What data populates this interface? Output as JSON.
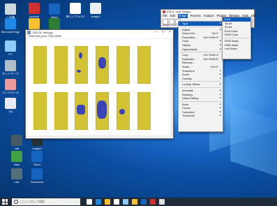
{
  "desktop": {
    "icons_left": [
      {
        "label": "ごみ箱",
        "icon": "recycle-bin-icon",
        "color": "#cfd8dc"
      },
      {
        "label": "Microsoft Edge",
        "icon": "edge-icon",
        "color": "#1e88e5"
      },
      {
        "label": "PC",
        "icon": "pc-icon",
        "color": "#90caf9"
      },
      {
        "label": "ネットワーク",
        "icon": "network-icon",
        "color": "#b0bec5"
      },
      {
        "label": "コントロール",
        "icon": "control-panel-icon",
        "color": "#ef9a9a"
      },
      {
        "label": "Fiji",
        "icon": "fiji-icon",
        "color": "#e8eaf6"
      }
    ],
    "icons_top": [
      {
        "label": "Acrobat",
        "icon": "acrobat-icon",
        "color": "#d32f2f"
      },
      {
        "label": "Word",
        "icon": "word-icon",
        "color": "#1565c0"
      },
      {
        "label": "新しいフォルダ",
        "icon": "folder-icon",
        "color": "#ffffff"
      },
      {
        "label": "ImageJ",
        "icon": "imagej-icon",
        "color": "#eceff1"
      }
    ],
    "icons_row2": [
      {
        "label": "Chrome",
        "icon": "chrome-icon",
        "color": "#fbc02d"
      },
      {
        "label": "Excel",
        "icon": "excel-icon",
        "color": "#2e7d32"
      }
    ],
    "icons_bottom": [
      {
        "label": "Lab",
        "icon": "app-icon",
        "color": "#455a64"
      },
      {
        "label": "ImageJ",
        "icon": "app-icon",
        "color": "#263238"
      },
      {
        "label": "data",
        "icon": "spreadsheet-icon",
        "color": "#43a047"
      },
      {
        "label": "Word",
        "icon": "word-icon",
        "color": "#1565c0"
      },
      {
        "label": "Lab",
        "icon": "app-icon",
        "color": "#546e7a"
      },
      {
        "label": "Document",
        "icon": "word-icon",
        "color": "#1565c0"
      }
    ]
  },
  "image_window": {
    "title": "DSC01_test.jpg",
    "info": "7068x2456 pixels; RGB; 66MB"
  },
  "imagej": {
    "title": "(Fiji Is Just) ImageJ",
    "menus": [
      "File",
      "Edit",
      "Image",
      "Process",
      "Analyze",
      "Plugins",
      "Window",
      "Help",
      "SMS"
    ],
    "active_menu": "Image",
    "status": "ImageJ 1.53"
  },
  "image_menu": {
    "items": [
      {
        "label": "Type",
        "shortcut": "",
        "submenu": true,
        "highlight": true
      },
      {
        "sep": true
      },
      {
        "label": "Adjust",
        "shortcut": "",
        "submenu": true
      },
      {
        "label": "Show Info...",
        "shortcut": "Ctrl+I"
      },
      {
        "label": "Properties...",
        "shortcut": "Ctrl+Shift+P"
      },
      {
        "label": "Color",
        "shortcut": "",
        "submenu": true
      },
      {
        "label": "Stacks",
        "shortcut": "",
        "submenu": true
      },
      {
        "label": "Hyperstacks",
        "shortcut": "",
        "submenu": true
      },
      {
        "sep": true
      },
      {
        "label": "Crop",
        "shortcut": "Ctrl+Shift+X"
      },
      {
        "label": "Duplicate...",
        "shortcut": "Ctrl+Shift+D"
      },
      {
        "label": "Rename...",
        "shortcut": ""
      },
      {
        "label": "Scale...",
        "shortcut": "Ctrl+E"
      },
      {
        "label": "Transform",
        "shortcut": "",
        "submenu": true
      },
      {
        "label": "Zoom",
        "shortcut": "",
        "submenu": true
      },
      {
        "label": "Overlay",
        "shortcut": "",
        "submenu": true
      },
      {
        "sep": true
      },
      {
        "label": "Lookup Tables",
        "shortcut": "",
        "submenu": true
      },
      {
        "sep": true
      },
      {
        "label": "Annotate",
        "shortcut": "",
        "submenu": true
      },
      {
        "label": "Drawing",
        "shortcut": "",
        "submenu": true
      },
      {
        "label": "Video Editing",
        "shortcut": "",
        "submenu": true
      },
      {
        "sep": true
      },
      {
        "label": "Axes",
        "shortcut": "",
        "submenu": true
      },
      {
        "label": "Cursor",
        "shortcut": "",
        "submenu": true
      },
      {
        "label": "Calculator",
        "shortcut": "",
        "submenu": true
      },
      {
        "label": "Threshold",
        "shortcut": "",
        "submenu": true
      }
    ]
  },
  "type_submenu": {
    "items": [
      "8-bit",
      "16-bit",
      "32-bit",
      "8-bit Color",
      "RGB Color",
      "",
      "RGB Stack",
      "HSB Stack",
      "Lab Stack"
    ],
    "highlight_index": 0
  },
  "taskbar": {
    "search_placeholder": "ここに入力して検索",
    "time": "",
    "apps": [
      {
        "name": "task-view-icon",
        "color": "#ffffff"
      },
      {
        "name": "edge-icon",
        "color": "#1e88e5"
      },
      {
        "name": "explorer-icon",
        "color": "#fbc02d"
      },
      {
        "name": "store-icon",
        "color": "#ffffff"
      },
      {
        "name": "mail-icon",
        "color": "#90caf9"
      },
      {
        "name": "chrome-icon",
        "color": "#fbc02d"
      },
      {
        "name": "word-icon",
        "color": "#1565c0"
      },
      {
        "name": "imagej-icon",
        "color": "#d32f2f"
      },
      {
        "name": "fiji-icon",
        "color": "#e0e0e0"
      }
    ]
  }
}
